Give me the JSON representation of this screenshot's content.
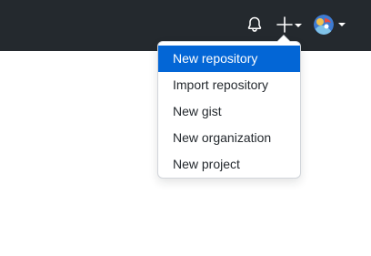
{
  "header": {
    "notifications_icon": "bell-icon",
    "create_icon": "plus-icon",
    "avatar_icon": "user-avatar"
  },
  "create_menu": {
    "items": [
      {
        "label": "New repository",
        "active": true
      },
      {
        "label": "Import repository",
        "active": false
      },
      {
        "label": "New gist",
        "active": false
      },
      {
        "label": "New organization",
        "active": false
      },
      {
        "label": "New project",
        "active": false
      }
    ]
  },
  "colors": {
    "header_bg": "#24292e",
    "accent": "#0366d6",
    "text": "#24292e",
    "border": "#d1d5da"
  }
}
